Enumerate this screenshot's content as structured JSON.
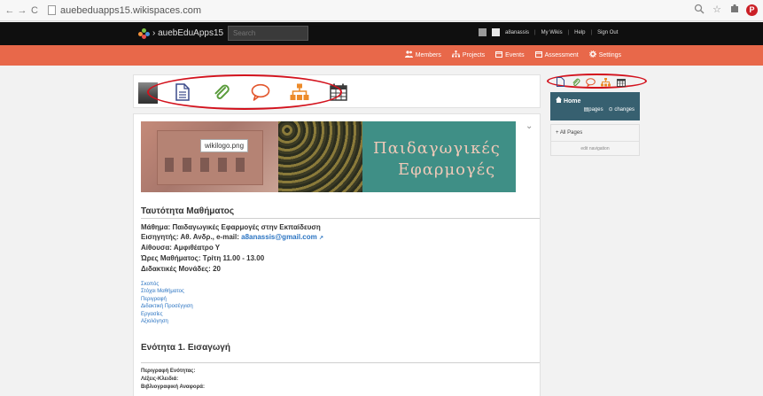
{
  "browser": {
    "url": "auebeduapps15.wikispaces.com",
    "back_glyph": "←",
    "forward_glyph": "→",
    "reload_glyph": "C"
  },
  "topbar": {
    "site_name": "› auebEduApps15",
    "search_placeholder": "Search",
    "user": "a8anassis",
    "links": [
      "My Wikis",
      "Help",
      "Sign Out"
    ],
    "separator": "|"
  },
  "navbar": {
    "items": [
      {
        "icon": "members-icon",
        "label": "Members"
      },
      {
        "icon": "projects-icon",
        "label": "Projects"
      },
      {
        "icon": "events-icon",
        "label": "Events"
      },
      {
        "icon": "assessment-icon",
        "label": "Assessment"
      },
      {
        "icon": "settings-icon",
        "label": "Settings"
      }
    ]
  },
  "toolbar": {
    "icons": [
      "page-icon",
      "attachment-icon",
      "comment-icon",
      "hierarchy-icon",
      "calendar-icon"
    ]
  },
  "banner": {
    "image_label": "wikilogo.png",
    "title_line1": "Παιδαγωγικές",
    "title_line2": "Εφαρμογές"
  },
  "section1": {
    "heading": "Ταυτότητα Μαθήματος",
    "course": "Μάθημα: Παιδαγωγικές Εφαρμογές στην Εκπαίδευση",
    "instructor_prefix": "Εισηγητής: Αθ. Ανδρ., e-mail: ",
    "instructor_email": "a8anassis@gmail.com",
    "room": "Αίθουσα: Αμφιθέατρο Υ",
    "hours": "Ώρες Μαθήματος: Τρίτη 11.00 - 13.00",
    "credits": "Διδακτικές Μονάδες: 20"
  },
  "toc": [
    "Σκοπός",
    "Στόχοι Μαθήματος",
    "Περιγραφή",
    "Διδακτική Προσέγγιση",
    "Εργασίες",
    "Αξιολόγηση"
  ],
  "section2": {
    "heading": "Ενότητα 1. Εισαγωγή",
    "fields": [
      "Περιγραφή Ενότητας:",
      "Λέξεις-Κλειδιά:",
      "Βιβλιογραφική Αναφορά:"
    ]
  },
  "sidebar": {
    "home_label": "Home",
    "pages_label": "pages",
    "changes_label": "changes",
    "all_pages": "+ All Pages",
    "edit_navigation": "edit navigation"
  },
  "colors": {
    "annotation_red": "#d3121d",
    "nav_orange": "#e8684a",
    "home_teal": "#376070"
  }
}
